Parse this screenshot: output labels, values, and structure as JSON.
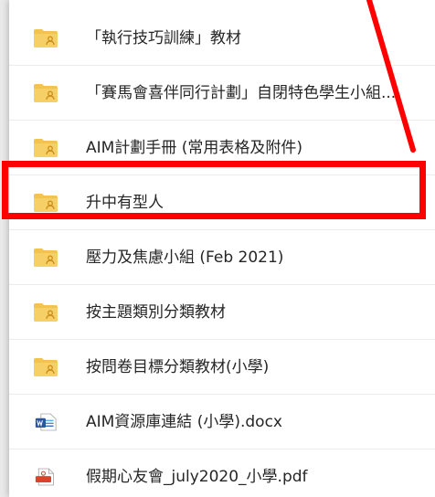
{
  "file_list": {
    "items": [
      {
        "label": "「執行技巧訓練」教材",
        "icon": "shared-folder-icon"
      },
      {
        "label": "「賽馬會喜伴同行計劃」自閉特色學生小組...",
        "icon": "shared-folder-icon"
      },
      {
        "label": "AIM計劃手冊 (常用表格及附件)",
        "icon": "shared-folder-icon"
      },
      {
        "label": "升中有型人",
        "icon": "shared-folder-icon",
        "highlighted": true
      },
      {
        "label": "壓力及焦慮小組 (Feb 2021)",
        "icon": "shared-folder-icon"
      },
      {
        "label": "按主題類別分類教材",
        "icon": "shared-folder-icon"
      },
      {
        "label": "按問卷目標分類教材(小學)",
        "icon": "shared-folder-icon"
      },
      {
        "label": "AIM資源庫連結 (小學).docx",
        "icon": "word-file-icon"
      },
      {
        "label": "假期心友會_july2020_小學.pdf",
        "icon": "pdf-file-icon"
      }
    ]
  },
  "colors": {
    "folder": "#f3c34f",
    "folder_shade": "#e7ad2c",
    "person": "#c9901a",
    "word": "#2b579a",
    "pdf": "#d9452b",
    "highlight": "#ff0000"
  }
}
